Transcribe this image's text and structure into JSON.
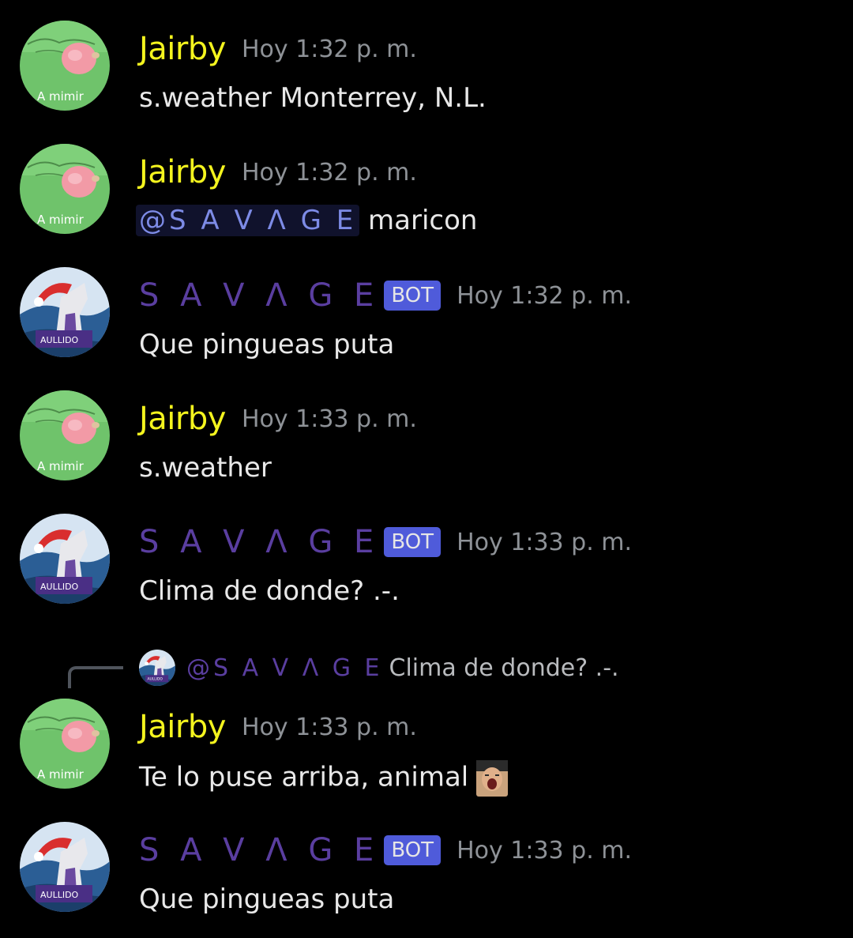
{
  "users": {
    "jairby": {
      "name": "Jairby",
      "avatar_text": "A mimir",
      "color": "#f4f41e"
    },
    "savage": {
      "name": "S A V Λ G E",
      "bot_tag": "BOT",
      "color": "#5a3ea0"
    }
  },
  "messages": [
    {
      "author": "Jairby",
      "time": "Hoy 1:32 p. m.",
      "text": "s.weather Monterrey, N.L."
    },
    {
      "author": "Jairby",
      "time": "Hoy 1:32 p. m.",
      "mention": "@S A V Λ G E",
      "text": " maricon"
    },
    {
      "author": "S A V Λ G E",
      "bot_tag": "BOT",
      "time": "Hoy 1:32 p. m.",
      "text": "Que pingueas puta"
    },
    {
      "author": "Jairby",
      "time": "Hoy 1:33 p. m.",
      "text": "s.weather"
    },
    {
      "author": "S A V Λ G E",
      "bot_tag": "BOT",
      "time": "Hoy 1:33 p. m.",
      "text": "Clima de donde? .-."
    },
    {
      "author": "Jairby",
      "time": "Hoy 1:33 p. m.",
      "reply": {
        "mention": "@S A V Λ G E",
        "text": "Clima de donde? .-."
      },
      "text": "Te lo puse arriba, animal",
      "emoji": "screaming-face-emoji"
    },
    {
      "author": "S A V Λ G E",
      "bot_tag": "BOT",
      "time": "Hoy 1:33 p. m.",
      "text": "Que pingueas puta"
    }
  ]
}
